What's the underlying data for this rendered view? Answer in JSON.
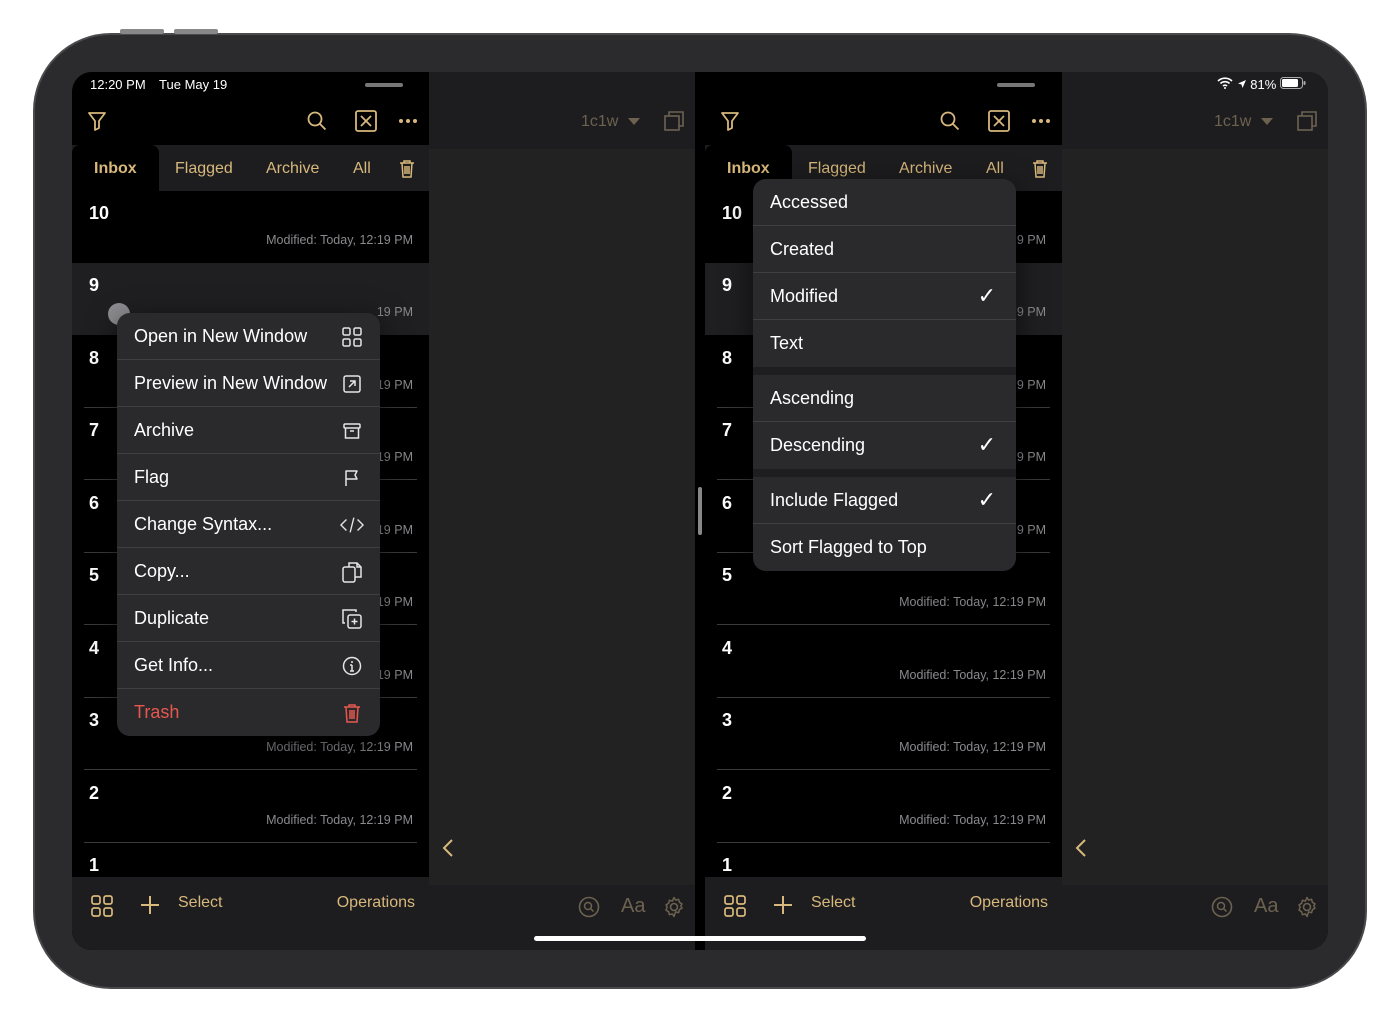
{
  "status": {
    "time": "12:20 PM",
    "date": "Tue May 19",
    "battery": "81%"
  },
  "left": {
    "tabs": [
      "Inbox",
      "Flagged",
      "Archive",
      "All"
    ],
    "notes": [
      {
        "num": "10",
        "modified": "Modified: Today, 12:19 PM"
      },
      {
        "num": "9",
        "modified": "19 PM"
      },
      {
        "num": "8",
        "modified": "19 PM"
      },
      {
        "num": "7",
        "modified": "19 PM"
      },
      {
        "num": "6",
        "modified": "19 PM"
      },
      {
        "num": "5",
        "modified": "19 PM"
      },
      {
        "num": "4",
        "modified": "19 PM"
      },
      {
        "num": "3",
        "modified": "Modified: Today, 12:19 PM"
      },
      {
        "num": "2",
        "modified": "Modified: Today, 12:19 PM"
      },
      {
        "num": "1",
        "modified": ""
      }
    ],
    "bottom": {
      "select": "Select",
      "operations": "Operations"
    },
    "context_menu": [
      {
        "label": "Open in New Window",
        "icon": "grid-window-icon"
      },
      {
        "label": "Preview in New Window",
        "icon": "arrow-out-window-icon"
      },
      {
        "label": "Archive",
        "icon": "archive-box-icon"
      },
      {
        "label": "Flag",
        "icon": "flag-icon"
      },
      {
        "label": "Change Syntax...",
        "icon": "code-brackets-icon"
      },
      {
        "label": "Copy...",
        "icon": "copy-docs-icon"
      },
      {
        "label": "Duplicate",
        "icon": "duplicate-plus-icon"
      },
      {
        "label": "Get Info...",
        "icon": "info-circle-icon"
      },
      {
        "label": "Trash",
        "icon": "trash-icon"
      }
    ]
  },
  "preview": {
    "syntax": "1c1w"
  },
  "right": {
    "tabs": [
      "Inbox",
      "Flagged",
      "Archive",
      "All"
    ],
    "notes": [
      {
        "num": "10",
        "modified": "9 PM"
      },
      {
        "num": "9",
        "modified": "9 PM"
      },
      {
        "num": "8",
        "modified": "9 PM"
      },
      {
        "num": "7",
        "modified": "9 PM"
      },
      {
        "num": "6",
        "modified": "9 PM"
      },
      {
        "num": "5",
        "modified": "Modified: Today, 12:19 PM"
      },
      {
        "num": "4",
        "modified": "Modified: Today, 12:19 PM"
      },
      {
        "num": "3",
        "modified": "Modified: Today, 12:19 PM"
      },
      {
        "num": "2",
        "modified": "Modified: Today, 12:19 PM"
      },
      {
        "num": "1",
        "modified": ""
      }
    ],
    "bottom": {
      "select": "Select",
      "operations": "Operations"
    },
    "sort_menu": {
      "group1": [
        {
          "label": "Accessed",
          "checked": false
        },
        {
          "label": "Created",
          "checked": false
        },
        {
          "label": "Modified",
          "checked": true
        },
        {
          "label": "Text",
          "checked": false
        }
      ],
      "group2": [
        {
          "label": "Ascending",
          "checked": false
        },
        {
          "label": "Descending",
          "checked": true
        }
      ],
      "group3": [
        {
          "label": "Include Flagged",
          "checked": true
        },
        {
          "label": "Sort Flagged to Top",
          "checked": false
        }
      ],
      "check_glyph": "✓"
    }
  },
  "colors": {
    "accent": "#d8b87c",
    "danger": "#e8574f",
    "background": "#000000",
    "bar": "#1d1d1f"
  }
}
